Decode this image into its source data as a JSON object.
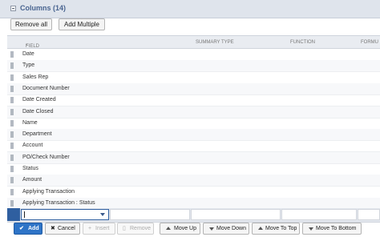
{
  "header": {
    "title": "Columns (14)"
  },
  "toolbar": {
    "remove_all": "Remove all",
    "add_multiple": "Add Multiple"
  },
  "columns": {
    "field": "FIELD",
    "required_marker": "*",
    "summary_type": "SUMMARY TYPE",
    "function": "FUNCTION",
    "formula": "FORMU"
  },
  "rows": [
    "Date",
    "Type",
    "Sales Rep",
    "Document Number",
    "Date Created",
    "Date Closed",
    "Name",
    "Department",
    "Account",
    "PO/Check Number",
    "Status",
    "Amount",
    "Applying Transaction",
    "Applying Transaction : Status"
  ],
  "actions": {
    "add": "Add",
    "cancel": "Cancel",
    "insert": "Insert",
    "remove": "Remove",
    "move_up": "Move Up",
    "move_down": "Move Down",
    "move_to_top": "Move To Top",
    "move_to_bottom": "Move To Bottom"
  },
  "icons": {
    "add": "check-icon",
    "cancel": "x-icon",
    "insert": "plus-icon",
    "remove": "trash-icon",
    "move_up": "arrow-up-icon",
    "move_down": "arrow-down-icon",
    "move_to_top": "arrow-top-icon",
    "move_to_bottom": "arrow-bottom-icon"
  },
  "colors": {
    "accent": "#2e74c7",
    "header_title": "#4a6591",
    "required": "#e07000"
  }
}
